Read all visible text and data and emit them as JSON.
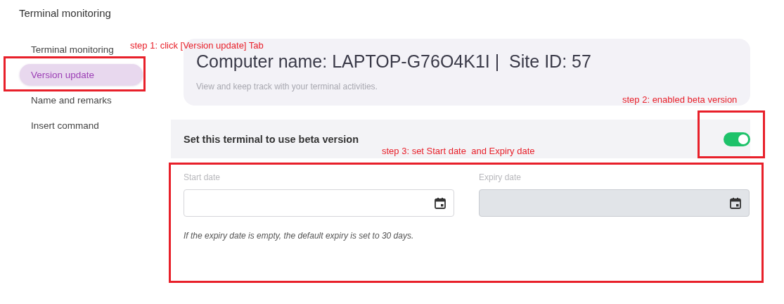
{
  "page_title": "Terminal monitoring",
  "sidebar": {
    "items": [
      {
        "label": "Terminal monitoring",
        "selected": false
      },
      {
        "label": "Version update",
        "selected": true
      },
      {
        "label": "Name and remarks",
        "selected": false
      },
      {
        "label": "Insert command",
        "selected": false
      }
    ]
  },
  "header": {
    "title": "Computer name: LAPTOP-G76O4K1I |  Site ID: 57",
    "subtitle": "View and keep track with your terminal activities."
  },
  "beta": {
    "label": "Set this terminal to use beta version",
    "on": true
  },
  "dates": {
    "fields": [
      {
        "label": "Start date",
        "disabled": false
      },
      {
        "label": "Expiry date",
        "disabled": true
      }
    ],
    "note": "If the expiry date is empty, the default expiry is set to 30 days."
  },
  "annotations": [
    {
      "text": "step 1: click [Version update] Tab"
    },
    {
      "text": "step 2: enabled beta version"
    },
    {
      "text": "step 3: set Start date  and Expiry date"
    }
  ]
}
